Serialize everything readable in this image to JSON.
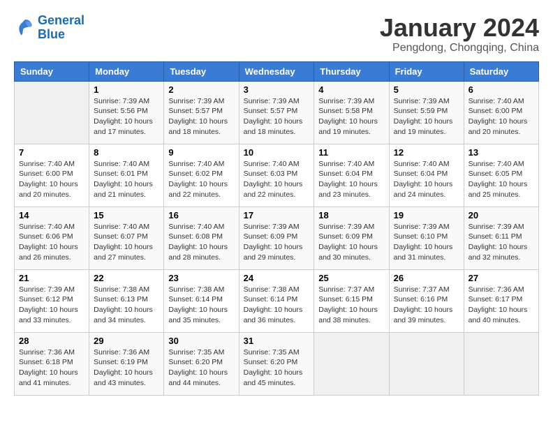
{
  "logo": {
    "line1": "General",
    "line2": "Blue"
  },
  "title": "January 2024",
  "location": "Pengdong, Chongqing, China",
  "headers": [
    "Sunday",
    "Monday",
    "Tuesday",
    "Wednesday",
    "Thursday",
    "Friday",
    "Saturday"
  ],
  "weeks": [
    [
      {
        "day": "",
        "info": ""
      },
      {
        "day": "1",
        "info": "Sunrise: 7:39 AM\nSunset: 5:56 PM\nDaylight: 10 hours\nand 17 minutes."
      },
      {
        "day": "2",
        "info": "Sunrise: 7:39 AM\nSunset: 5:57 PM\nDaylight: 10 hours\nand 18 minutes."
      },
      {
        "day": "3",
        "info": "Sunrise: 7:39 AM\nSunset: 5:57 PM\nDaylight: 10 hours\nand 18 minutes."
      },
      {
        "day": "4",
        "info": "Sunrise: 7:39 AM\nSunset: 5:58 PM\nDaylight: 10 hours\nand 19 minutes."
      },
      {
        "day": "5",
        "info": "Sunrise: 7:39 AM\nSunset: 5:59 PM\nDaylight: 10 hours\nand 19 minutes."
      },
      {
        "day": "6",
        "info": "Sunrise: 7:40 AM\nSunset: 6:00 PM\nDaylight: 10 hours\nand 20 minutes."
      }
    ],
    [
      {
        "day": "7",
        "info": "Sunrise: 7:40 AM\nSunset: 6:00 PM\nDaylight: 10 hours\nand 20 minutes."
      },
      {
        "day": "8",
        "info": "Sunrise: 7:40 AM\nSunset: 6:01 PM\nDaylight: 10 hours\nand 21 minutes."
      },
      {
        "day": "9",
        "info": "Sunrise: 7:40 AM\nSunset: 6:02 PM\nDaylight: 10 hours\nand 22 minutes."
      },
      {
        "day": "10",
        "info": "Sunrise: 7:40 AM\nSunset: 6:03 PM\nDaylight: 10 hours\nand 22 minutes."
      },
      {
        "day": "11",
        "info": "Sunrise: 7:40 AM\nSunset: 6:04 PM\nDaylight: 10 hours\nand 23 minutes."
      },
      {
        "day": "12",
        "info": "Sunrise: 7:40 AM\nSunset: 6:04 PM\nDaylight: 10 hours\nand 24 minutes."
      },
      {
        "day": "13",
        "info": "Sunrise: 7:40 AM\nSunset: 6:05 PM\nDaylight: 10 hours\nand 25 minutes."
      }
    ],
    [
      {
        "day": "14",
        "info": "Sunrise: 7:40 AM\nSunset: 6:06 PM\nDaylight: 10 hours\nand 26 minutes."
      },
      {
        "day": "15",
        "info": "Sunrise: 7:40 AM\nSunset: 6:07 PM\nDaylight: 10 hours\nand 27 minutes."
      },
      {
        "day": "16",
        "info": "Sunrise: 7:40 AM\nSunset: 6:08 PM\nDaylight: 10 hours\nand 28 minutes."
      },
      {
        "day": "17",
        "info": "Sunrise: 7:39 AM\nSunset: 6:09 PM\nDaylight: 10 hours\nand 29 minutes."
      },
      {
        "day": "18",
        "info": "Sunrise: 7:39 AM\nSunset: 6:09 PM\nDaylight: 10 hours\nand 30 minutes."
      },
      {
        "day": "19",
        "info": "Sunrise: 7:39 AM\nSunset: 6:10 PM\nDaylight: 10 hours\nand 31 minutes."
      },
      {
        "day": "20",
        "info": "Sunrise: 7:39 AM\nSunset: 6:11 PM\nDaylight: 10 hours\nand 32 minutes."
      }
    ],
    [
      {
        "day": "21",
        "info": "Sunrise: 7:39 AM\nSunset: 6:12 PM\nDaylight: 10 hours\nand 33 minutes."
      },
      {
        "day": "22",
        "info": "Sunrise: 7:38 AM\nSunset: 6:13 PM\nDaylight: 10 hours\nand 34 minutes."
      },
      {
        "day": "23",
        "info": "Sunrise: 7:38 AM\nSunset: 6:14 PM\nDaylight: 10 hours\nand 35 minutes."
      },
      {
        "day": "24",
        "info": "Sunrise: 7:38 AM\nSunset: 6:14 PM\nDaylight: 10 hours\nand 36 minutes."
      },
      {
        "day": "25",
        "info": "Sunrise: 7:37 AM\nSunset: 6:15 PM\nDaylight: 10 hours\nand 38 minutes."
      },
      {
        "day": "26",
        "info": "Sunrise: 7:37 AM\nSunset: 6:16 PM\nDaylight: 10 hours\nand 39 minutes."
      },
      {
        "day": "27",
        "info": "Sunrise: 7:36 AM\nSunset: 6:17 PM\nDaylight: 10 hours\nand 40 minutes."
      }
    ],
    [
      {
        "day": "28",
        "info": "Sunrise: 7:36 AM\nSunset: 6:18 PM\nDaylight: 10 hours\nand 41 minutes."
      },
      {
        "day": "29",
        "info": "Sunrise: 7:36 AM\nSunset: 6:19 PM\nDaylight: 10 hours\nand 43 minutes."
      },
      {
        "day": "30",
        "info": "Sunrise: 7:35 AM\nSunset: 6:20 PM\nDaylight: 10 hours\nand 44 minutes."
      },
      {
        "day": "31",
        "info": "Sunrise: 7:35 AM\nSunset: 6:20 PM\nDaylight: 10 hours\nand 45 minutes."
      },
      {
        "day": "",
        "info": ""
      },
      {
        "day": "",
        "info": ""
      },
      {
        "day": "",
        "info": ""
      }
    ]
  ]
}
